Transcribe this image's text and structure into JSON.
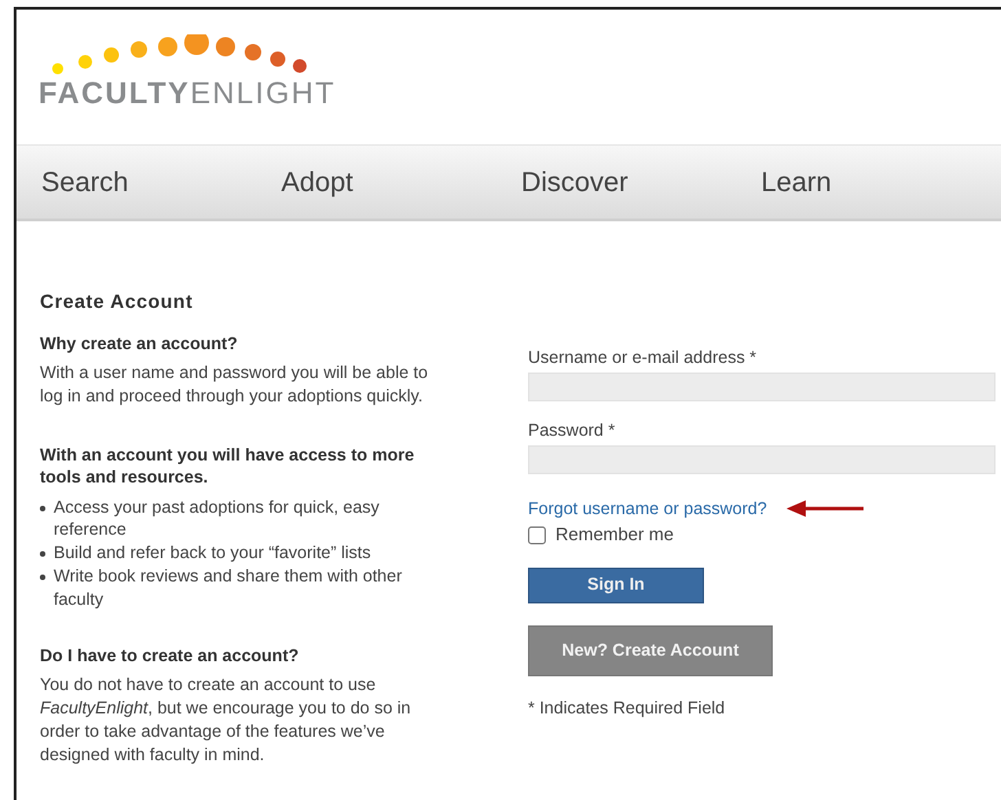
{
  "logo": {
    "bold_part": "FACULTY",
    "light_part": "ENLIGHT"
  },
  "nav": [
    {
      "label": "Search"
    },
    {
      "label": "Adopt"
    },
    {
      "label": "Discover"
    },
    {
      "label": "Learn"
    }
  ],
  "info": {
    "title": "Create Account",
    "sections": [
      {
        "heading": "Why create an account?",
        "text": "With a user name and password you will be able to log in and proceed through your adoptions quickly."
      },
      {
        "heading": "With an account you will have access to more tools and resources.",
        "bullets": [
          "Access your past adoptions for quick, easy reference",
          "Build and refer back to your “favorite” lists",
          "Write book reviews and share them with other faculty"
        ]
      },
      {
        "heading": "Do I have to create an account?",
        "text": "You do not have to create an account to use *FacultyEnlight*, but we encourage you to do so in order to take advantage of the features we’ve designed with faculty in mind."
      }
    ]
  },
  "login": {
    "fields": [
      {
        "label": "Username or e-mail address *"
      },
      {
        "label": "Password *"
      }
    ],
    "forgot_link": "Forgot username or password?",
    "remember": {
      "label": "Remember me",
      "checked": false
    },
    "sign_in": "Sign In",
    "create": "New? Create Account",
    "note": "* Indicates Required Field"
  }
}
